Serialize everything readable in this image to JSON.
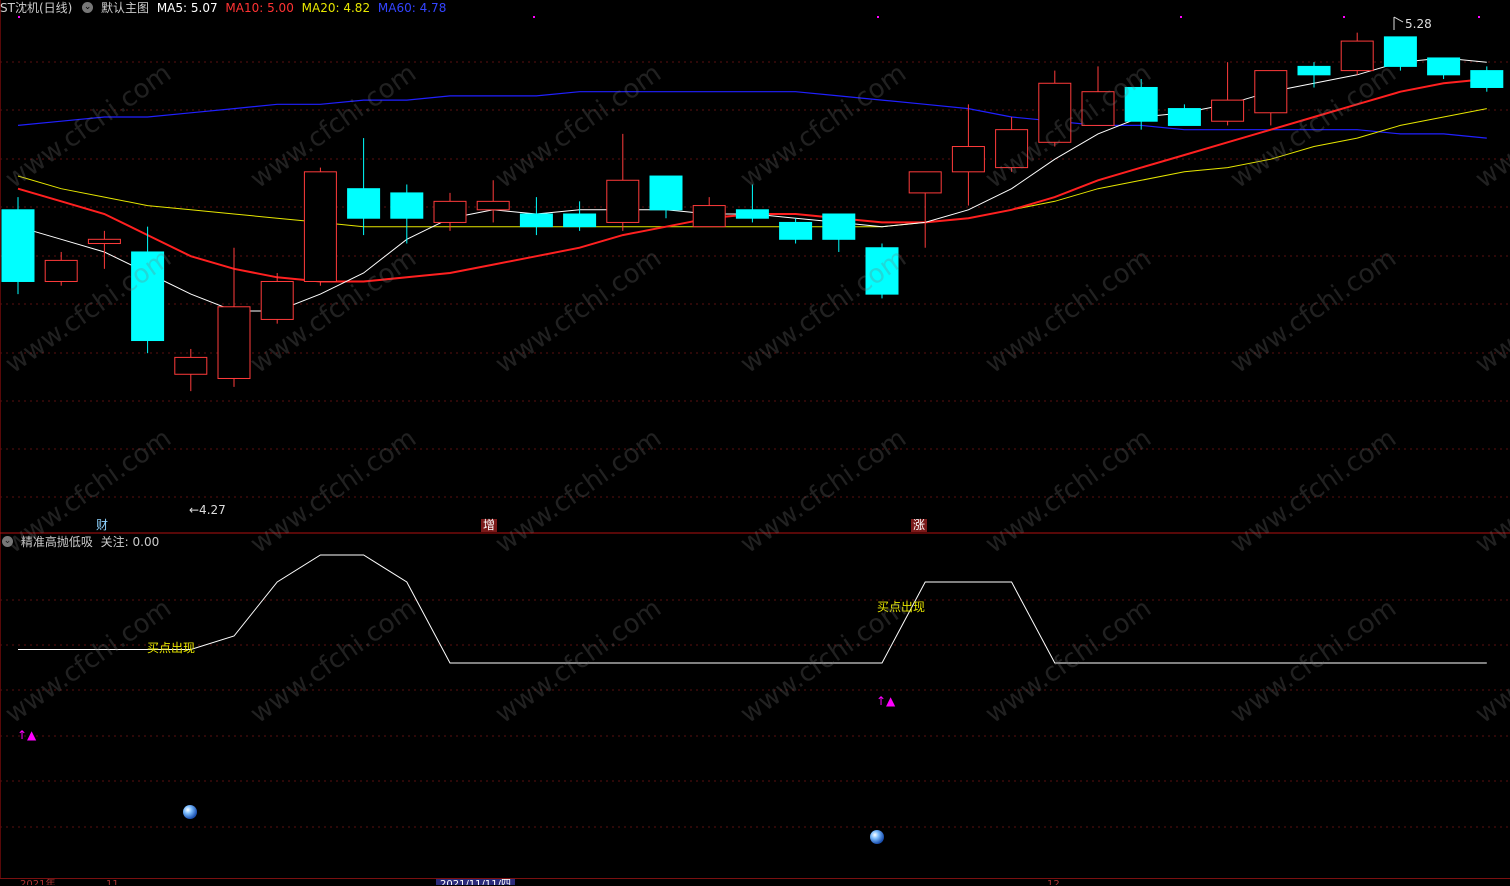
{
  "main_header": {
    "stock": "ST沈机(日线)",
    "template": "默认主图",
    "ma5": "MA5: 5.07",
    "ma10": "MA10: 5.00",
    "ma20": "MA20: 4.82",
    "ma60": "MA60: 4.78"
  },
  "indicator_header": {
    "name": "精准高抛低吸",
    "value": "关注: 0.00"
  },
  "markers": {
    "cai": "财",
    "zeng": "增",
    "zhang": "涨"
  },
  "price_labels": {
    "low": "←4.27",
    "high": "5.28"
  },
  "signals": {
    "buy1": "买点出现",
    "buy2": "买点出现",
    "arrow": "↑▲"
  },
  "dates": {
    "highlight": "2021/11/11/四",
    "left": "2021年",
    "d1": "11",
    "d2": "12"
  },
  "watermark": "www.cfchi.com",
  "colors": {
    "up": "#ff3b3b",
    "down": "#00ffff",
    "ma5": "#ffffff",
    "ma10": "#ff2020",
    "ma20": "#e6e600",
    "ma60": "#2020ff",
    "grid": "#5a1010",
    "signal": "#ff00ff"
  },
  "chart_data": [
    {
      "type": "candlestick",
      "title": "ST沈机(日线)",
      "ylim": [
        4.2,
        5.35
      ],
      "candles": [
        {
          "o": 4.9,
          "c": 4.73,
          "h": 4.93,
          "l": 4.7
        },
        {
          "o": 4.73,
          "c": 4.78,
          "h": 4.8,
          "l": 4.72
        },
        {
          "o": 4.82,
          "c": 4.83,
          "h": 4.85,
          "l": 4.76
        },
        {
          "o": 4.8,
          "c": 4.59,
          "h": 4.86,
          "l": 4.56
        },
        {
          "o": 4.51,
          "c": 4.55,
          "h": 4.57,
          "l": 4.47
        },
        {
          "o": 4.5,
          "c": 4.67,
          "h": 4.81,
          "l": 4.48
        },
        {
          "o": 4.64,
          "c": 4.73,
          "h": 4.75,
          "l": 4.63
        },
        {
          "o": 4.73,
          "c": 4.99,
          "h": 5.0,
          "l": 4.72
        },
        {
          "o": 4.95,
          "c": 4.88,
          "h": 5.07,
          "l": 4.84
        },
        {
          "o": 4.94,
          "c": 4.88,
          "h": 4.96,
          "l": 4.82
        },
        {
          "o": 4.87,
          "c": 4.92,
          "h": 4.94,
          "l": 4.85
        },
        {
          "o": 4.9,
          "c": 4.92,
          "h": 4.97,
          "l": 4.87
        },
        {
          "o": 4.89,
          "c": 4.86,
          "h": 4.93,
          "l": 4.84
        },
        {
          "o": 4.89,
          "c": 4.86,
          "h": 4.92,
          "l": 4.85
        },
        {
          "o": 4.87,
          "c": 4.97,
          "h": 5.08,
          "l": 4.85
        },
        {
          "o": 4.98,
          "c": 4.9,
          "h": 4.98,
          "l": 4.88
        },
        {
          "o": 4.86,
          "c": 4.91,
          "h": 4.93,
          "l": 4.86
        },
        {
          "o": 4.9,
          "c": 4.88,
          "h": 4.96,
          "l": 4.87
        },
        {
          "o": 4.87,
          "c": 4.83,
          "h": 4.88,
          "l": 4.82
        },
        {
          "o": 4.89,
          "c": 4.83,
          "h": 4.89,
          "l": 4.8
        },
        {
          "o": 4.81,
          "c": 4.7,
          "h": 4.82,
          "l": 4.69
        },
        {
          "o": 4.94,
          "c": 4.99,
          "h": 4.99,
          "l": 4.81
        },
        {
          "o": 4.99,
          "c": 5.05,
          "h": 5.15,
          "l": 4.91
        },
        {
          "o": 5.0,
          "c": 5.09,
          "h": 5.12,
          "l": 4.99
        },
        {
          "o": 5.06,
          "c": 5.2,
          "h": 5.23,
          "l": 5.05
        },
        {
          "o": 5.1,
          "c": 5.18,
          "h": 5.24,
          "l": 5.1
        },
        {
          "o": 5.19,
          "c": 5.11,
          "h": 5.21,
          "l": 5.09
        },
        {
          "o": 5.14,
          "c": 5.1,
          "h": 5.15,
          "l": 5.1
        },
        {
          "o": 5.11,
          "c": 5.16,
          "h": 5.25,
          "l": 5.1
        },
        {
          "o": 5.13,
          "c": 5.23,
          "h": 5.23,
          "l": 5.1
        },
        {
          "o": 5.24,
          "c": 5.22,
          "h": 5.25,
          "l": 5.19
        },
        {
          "o": 5.23,
          "c": 5.3,
          "h": 5.32,
          "l": 5.22
        },
        {
          "o": 5.31,
          "c": 5.24,
          "h": 5.3,
          "l": 5.23
        },
        {
          "o": 5.26,
          "c": 5.22,
          "h": 5.26,
          "l": 5.21
        },
        {
          "o": 5.23,
          "c": 5.19,
          "h": 5.24,
          "l": 5.18
        }
      ],
      "ma5": [
        4.86,
        4.83,
        4.8,
        4.75,
        4.7,
        4.66,
        4.66,
        4.7,
        4.75,
        4.83,
        4.88,
        4.9,
        4.89,
        4.9,
        4.9,
        4.9,
        4.89,
        4.89,
        4.88,
        4.87,
        4.86,
        4.87,
        4.9,
        4.95,
        5.02,
        5.08,
        5.12,
        5.13,
        5.15,
        5.18,
        5.2,
        5.22,
        5.25,
        5.26,
        5.25
      ],
      "ma10": [
        4.95,
        4.92,
        4.89,
        4.84,
        4.79,
        4.76,
        4.74,
        4.73,
        4.73,
        4.74,
        4.75,
        4.77,
        4.79,
        4.81,
        4.84,
        4.86,
        4.88,
        4.89,
        4.89,
        4.88,
        4.87,
        4.87,
        4.88,
        4.9,
        4.93,
        4.97,
        5.0,
        5.03,
        5.06,
        5.09,
        5.12,
        5.15,
        5.18,
        5.2,
        5.21
      ],
      "ma20": [
        4.98,
        4.95,
        4.93,
        4.91,
        4.9,
        4.89,
        4.88,
        4.87,
        4.86,
        4.86,
        4.86,
        4.86,
        4.86,
        4.86,
        4.86,
        4.86,
        4.86,
        4.86,
        4.86,
        4.86,
        4.86,
        4.87,
        4.88,
        4.9,
        4.92,
        4.95,
        4.97,
        4.99,
        5.0,
        5.02,
        5.05,
        5.07,
        5.1,
        5.12,
        5.14
      ],
      "ma60": [
        5.1,
        5.11,
        5.12,
        5.12,
        5.13,
        5.14,
        5.15,
        5.15,
        5.16,
        5.16,
        5.17,
        5.17,
        5.17,
        5.18,
        5.18,
        5.18,
        5.18,
        5.18,
        5.18,
        5.17,
        5.16,
        5.15,
        5.14,
        5.12,
        5.11,
        5.1,
        5.1,
        5.09,
        5.09,
        5.09,
        5.09,
        5.09,
        5.08,
        5.08,
        5.07
      ],
      "low_label": 4.27,
      "high_label": 5.28
    },
    {
      "type": "line",
      "title": "精准高抛低吸",
      "ylim": [
        0,
        100
      ],
      "values": [
        30,
        30,
        30,
        30,
        30,
        40,
        80,
        100,
        100,
        80,
        20,
        20,
        20,
        20,
        20,
        20,
        20,
        20,
        20,
        20,
        20,
        80,
        80,
        80,
        20,
        20,
        20,
        20,
        20,
        20,
        20,
        20,
        20,
        20,
        20
      ]
    }
  ]
}
